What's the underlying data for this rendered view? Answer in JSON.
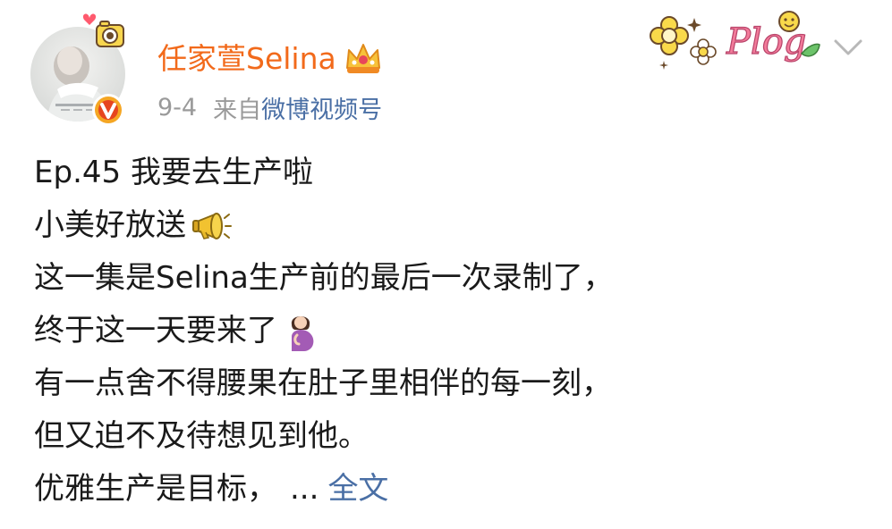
{
  "post": {
    "author": {
      "name": "任家萱Selina",
      "avatar_icon": "profile-photo",
      "verified_icon": "verified-v-icon",
      "crown_icon": "crown-icon"
    },
    "meta": {
      "date": "9-4",
      "from_prefix": "来自",
      "source": "微博视频号"
    },
    "sticker_text": "Plog",
    "content": {
      "lines": [
        "Ep.45 我要去生产啦",
        "小美好放送",
        "这一集是Selina生产前的最后一次录制了，",
        "终于这一天要来了",
        "有一点舍不得腰果在肚子里相伴的每一刻，",
        "但又迫不及待想见到他。",
        "优雅生产是目标，"
      ],
      "ellipsis": "...",
      "more_link": "全文"
    },
    "colors": {
      "username": "#f26a1b",
      "link": "#4a6fa5",
      "meta": "#9a9a9a"
    }
  }
}
